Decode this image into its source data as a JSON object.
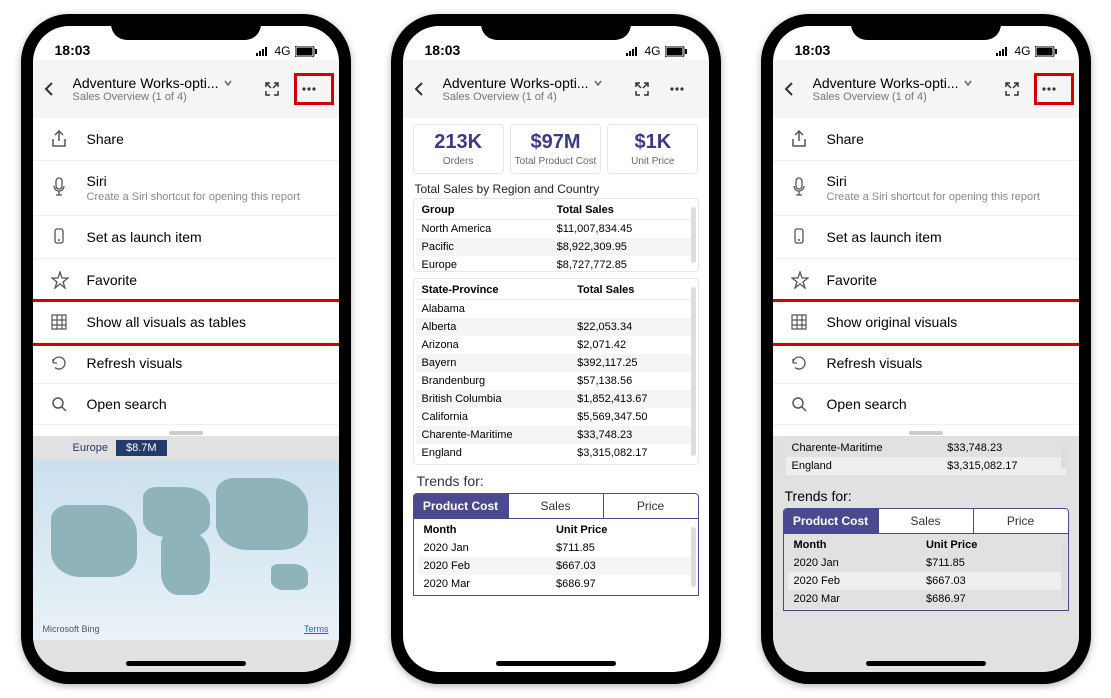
{
  "status": {
    "time": "18:03",
    "network": "4G"
  },
  "header": {
    "title": "Adventure Works-opti...",
    "subtitle": "Sales Overview (1 of 4)"
  },
  "menu": {
    "share": "Share",
    "siri": "Siri",
    "siri_sub": "Create a Siri shortcut for opening this report",
    "launch": "Set as launch item",
    "favorite": "Favorite",
    "show_tables": "Show all visuals as tables",
    "show_original": "Show original visuals",
    "refresh": "Refresh visuals",
    "search": "Open search"
  },
  "phone1_map": {
    "region": "Europe",
    "value": "$8.7M",
    "bing": "Microsoft Bing",
    "terms": "Terms"
  },
  "kpis": [
    {
      "value": "213K",
      "label": "Orders"
    },
    {
      "value": "$97M",
      "label": "Total Product Cost"
    },
    {
      "value": "$1K",
      "label": "Unit Price"
    }
  ],
  "region_title": "Total Sales by Region and Country",
  "groups": {
    "headers": [
      "Group",
      "Total Sales"
    ],
    "rows": [
      [
        "North America",
        "$11,007,834.45"
      ],
      [
        "Pacific",
        "$8,922,309.95"
      ],
      [
        "Europe",
        "$8,727,772.85"
      ]
    ]
  },
  "states": {
    "headers": [
      "State-Province",
      "Total Sales"
    ],
    "rows": [
      [
        "Alabama",
        ""
      ],
      [
        "Alberta",
        "$22,053.34"
      ],
      [
        "Arizona",
        "$2,071.42"
      ],
      [
        "Bayern",
        "$392,117.25"
      ],
      [
        "Brandenburg",
        "$57,138.56"
      ],
      [
        "British Columbia",
        "$1,852,413.67"
      ],
      [
        "California",
        "$5,569,347.50"
      ],
      [
        "Charente-Maritime",
        "$33,748.23"
      ],
      [
        "England",
        "$3,315,082.17"
      ]
    ]
  },
  "trends": {
    "title": "Trends for:",
    "tabs": [
      "Product Cost",
      "Sales",
      "Price"
    ],
    "active_tab": 0,
    "headers": [
      "Month",
      "Unit Price"
    ],
    "rows": [
      [
        "2020 Jan",
        "$711.85"
      ],
      [
        "2020 Feb",
        "$667.03"
      ],
      [
        "2020 Mar",
        "$686.97"
      ]
    ]
  },
  "phone3_visible_rows": [
    [
      "Charente-Maritime",
      "$33,748.23"
    ],
    [
      "England",
      "$3,315,082.17"
    ]
  ]
}
